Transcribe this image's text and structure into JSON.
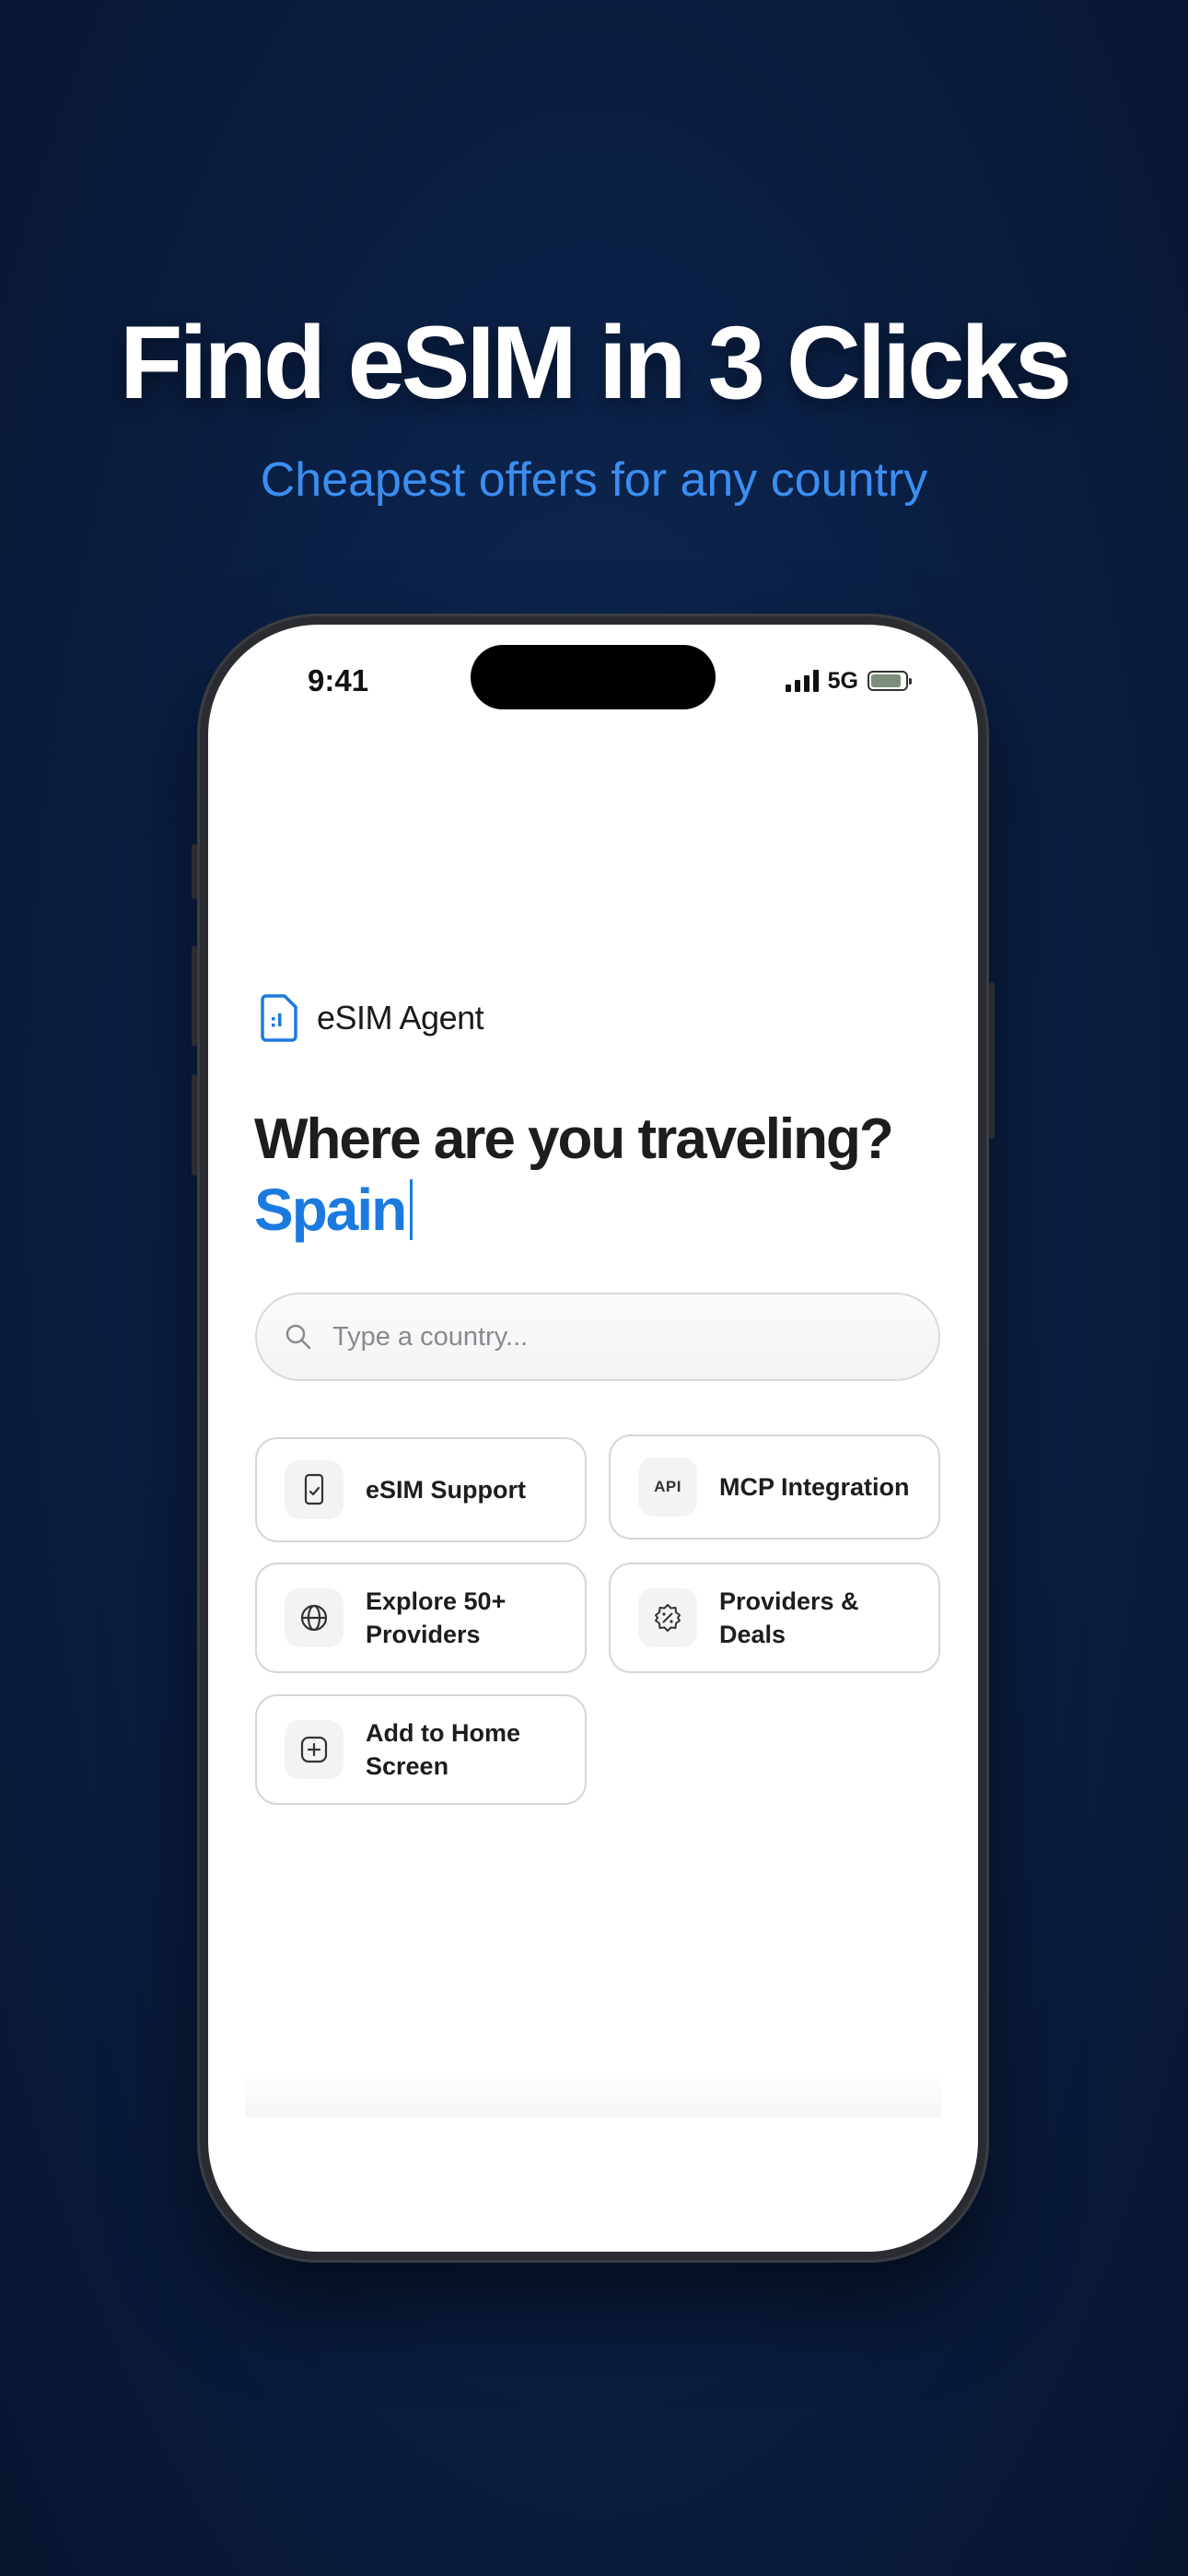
{
  "promo": {
    "headline": "Find eSIM in 3 Clicks",
    "subheadline": "Cheapest offers for any country"
  },
  "status_bar": {
    "time": "9:41",
    "network": "5G"
  },
  "app": {
    "brand_name": "eSIM Agent",
    "question": "Where are you traveling?",
    "typed_country": "Spain"
  },
  "search": {
    "placeholder": "Type a country...",
    "value": ""
  },
  "quick_actions": [
    {
      "label": "eSIM Support",
      "icon": "phone-check-icon"
    },
    {
      "label": "MCP Integration",
      "icon": "api-icon",
      "icon_text": "API"
    },
    {
      "label": "Explore 50+ Providers",
      "icon": "globe-icon"
    },
    {
      "label": "Providers & Deals",
      "icon": "discount-badge-icon"
    },
    {
      "label": "Add to Home Screen",
      "icon": "plus-square-icon"
    }
  ],
  "colors": {
    "accent": "#1B7AE0",
    "subheadline": "#3B8EF0",
    "background": "#0B2148"
  }
}
